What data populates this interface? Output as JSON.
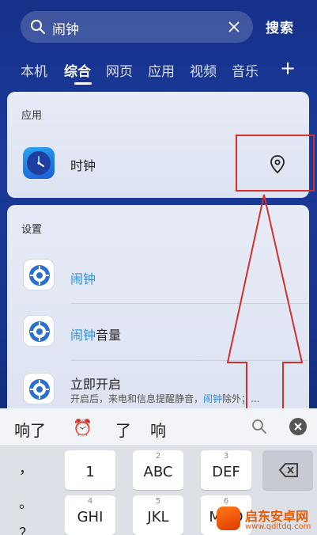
{
  "search": {
    "query": "闹钟",
    "button_label": "搜索"
  },
  "tabs": [
    {
      "label": "本机"
    },
    {
      "label": "综合"
    },
    {
      "label": "网页"
    },
    {
      "label": "应用"
    },
    {
      "label": "视频"
    },
    {
      "label": "音乐"
    }
  ],
  "tabs_more": "+",
  "apps_section": {
    "title": "应用",
    "items": [
      {
        "label": "时钟"
      }
    ]
  },
  "settings_section": {
    "title": "设置",
    "items": [
      {
        "highlight": "闹钟",
        "rest": ""
      },
      {
        "highlight": "闹钟",
        "rest": "音量"
      },
      {
        "title": "立即开启",
        "sub_before": "开启后，来电和信息提醒静音，",
        "sub_highlight": "闹钟",
        "sub_after": "除外；..."
      }
    ]
  },
  "suggestions": [
    "响了",
    "⏰",
    "了",
    "响"
  ],
  "keyboard": {
    "side_keys": [
      "，",
      "。",
      "？"
    ],
    "rows": [
      [
        {
          "sup": "",
          "main": "1"
        },
        {
          "sup": "2",
          "main": "ABC"
        },
        {
          "sup": "3",
          "main": "DEF"
        }
      ],
      [
        {
          "sup": "4",
          "main": "GHI"
        },
        {
          "sup": "5",
          "main": "JKL"
        },
        {
          "sup": "6",
          "main": "MNO"
        }
      ]
    ]
  },
  "watermark": {
    "title": "启东安卓网",
    "url": "www.qdltdq.com"
  },
  "colors": {
    "highlight": "#2a8ee0",
    "annotation": "#d32f2f",
    "background": "#1a3a9a"
  }
}
